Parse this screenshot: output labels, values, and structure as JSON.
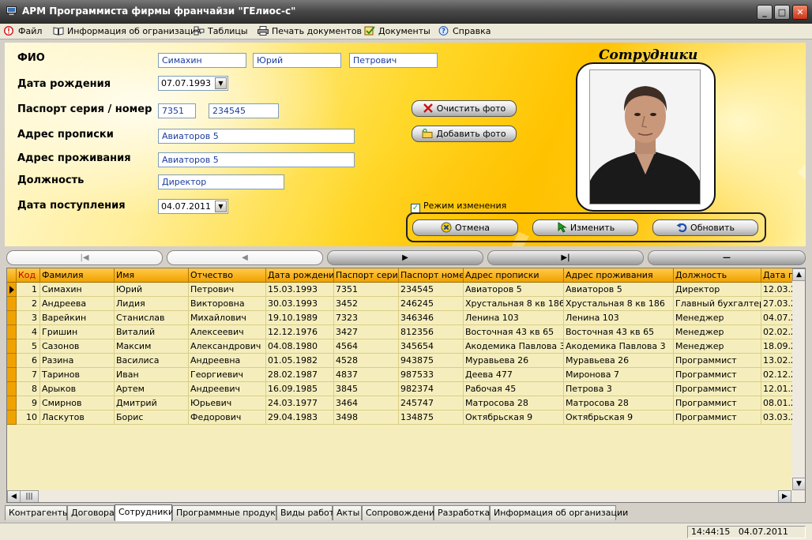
{
  "window": {
    "title": "АРМ Программиста фирмы франчайзи \"ГЕлиос-с\""
  },
  "menu": [
    {
      "label": "Файл",
      "icon": "warning-icon"
    },
    {
      "label": "Информация об огранизации",
      "icon": "book-icon"
    },
    {
      "label": "Таблицы",
      "icon": "tables-icon"
    },
    {
      "label": "Печать документов",
      "icon": "printer-icon"
    },
    {
      "label": "Документы",
      "icon": "documents-icon"
    },
    {
      "label": "Справка",
      "icon": "help-icon"
    }
  ],
  "form": {
    "fio_label": "ФИО",
    "last_name": "Симахин",
    "first_name": "Юрий",
    "middle_name": "Петрович",
    "birth_label": "Дата рождения",
    "birth_date": "07.07.1993",
    "passport_label": "Паспорт серия / номер",
    "passport_series": "7351",
    "passport_number": "234545",
    "reg_label": "Адрес прописки",
    "reg_address": "Авиаторов 5",
    "live_label": "Адрес проживания",
    "live_address": "Авиаторов 5",
    "position_label": "Должность",
    "position": "Директор",
    "hire_label": "Дата поступления",
    "hire_date": "04.07.2011",
    "clear_photo": "Очистить фото",
    "add_photo": "Добавить фото",
    "edit_mode": "Режим изменения",
    "cancel": "Отмена",
    "change": "Изменить",
    "refresh": "Обновить"
  },
  "photo": {
    "title": "Сотрудники"
  },
  "navigator": [
    "|◀",
    "◀",
    "▶",
    "▶|",
    "—"
  ],
  "table": {
    "columns": [
      "Код",
      "Фамилия",
      "Имя",
      "Отчество",
      "Дата рождения",
      "Паспорт серия",
      "Паспорт номер",
      "Адрес прописки",
      "Адрес проживания",
      "Должность",
      "Дата п"
    ],
    "rows": [
      [
        "1",
        "Симахин",
        "Юрий",
        "Петрович",
        "15.03.1993",
        "7351",
        "234545",
        "Авиаторов 5",
        "Авиаторов 5",
        "Директор",
        "12.03.2"
      ],
      [
        "2",
        "Андреева",
        "Лидия",
        "Викторовна",
        "30.03.1993",
        "3452",
        "246245",
        "Хрустальная 8 кв 186",
        "Хрустальная 8 кв 186",
        "Главный бухгалтер",
        "27.03.2"
      ],
      [
        "3",
        "Варейкин",
        "Станислав",
        "Михайлович",
        "19.10.1989",
        "7323",
        "346346",
        "Ленина 103",
        "Ленина 103",
        "Менеджер",
        "04.07.2"
      ],
      [
        "4",
        "Гришин",
        "Виталий",
        "Алексеевич",
        "12.12.1976",
        "3427",
        "812356",
        "Восточная 43 кв 65",
        "Восточная 43 кв 65",
        "Менеджер",
        "02.02.2"
      ],
      [
        "5",
        "Сазонов",
        "Максим",
        "Александрович",
        "04.08.1980",
        "4564",
        "345654",
        "Акодемика Павлова 3",
        "Акодемика Павлова 3",
        "Менеджер",
        "18.09.2"
      ],
      [
        "6",
        "Разина",
        "Василиса",
        "Андреевна",
        "01.05.1982",
        "4528",
        "943875",
        "Муравьева 26",
        "Муравьева 26",
        "Программист",
        "13.02.2"
      ],
      [
        "7",
        "Таринов",
        "Иван",
        "Георгиевич",
        "28.02.1987",
        "4837",
        "987533",
        "Деева 477",
        "Миронова 7",
        "Программист",
        "02.12.2"
      ],
      [
        "8",
        "Арыков",
        "Артем",
        "Андреевич",
        "16.09.1985",
        "3845",
        "982374",
        "Рабочая 45",
        "Петрова 3",
        "Программист",
        "12.01.2"
      ],
      [
        "9",
        "Смирнов",
        "Дмитрий",
        " Юрьевич",
        "24.03.1977",
        "3464",
        "245747",
        "Матросова 28",
        "Матросова 28",
        "Программист",
        "08.01.2"
      ],
      [
        "10",
        "Ласкутов",
        "Борис",
        "Федорович",
        "29.04.1983",
        "3498",
        "134875",
        "Октябрьская 9",
        "Октябрьская 9",
        "Программист",
        "03.03.2"
      ]
    ]
  },
  "tabs": [
    "Контрагенты",
    "Договора",
    "Сотрудники",
    "Программные продукты",
    "Виды работ",
    "Акты",
    "Сопровождение",
    "Разработка",
    "Информация об организации"
  ],
  "active_tab": "Сотрудники",
  "status": {
    "time": "14:44:15",
    "date": "04.07.2011"
  },
  "colors": {
    "grid_header": "#f0a200",
    "grid_bg": "#f5eebc",
    "code_header_text": "#c00000",
    "field_text": "#1a3d9e"
  }
}
